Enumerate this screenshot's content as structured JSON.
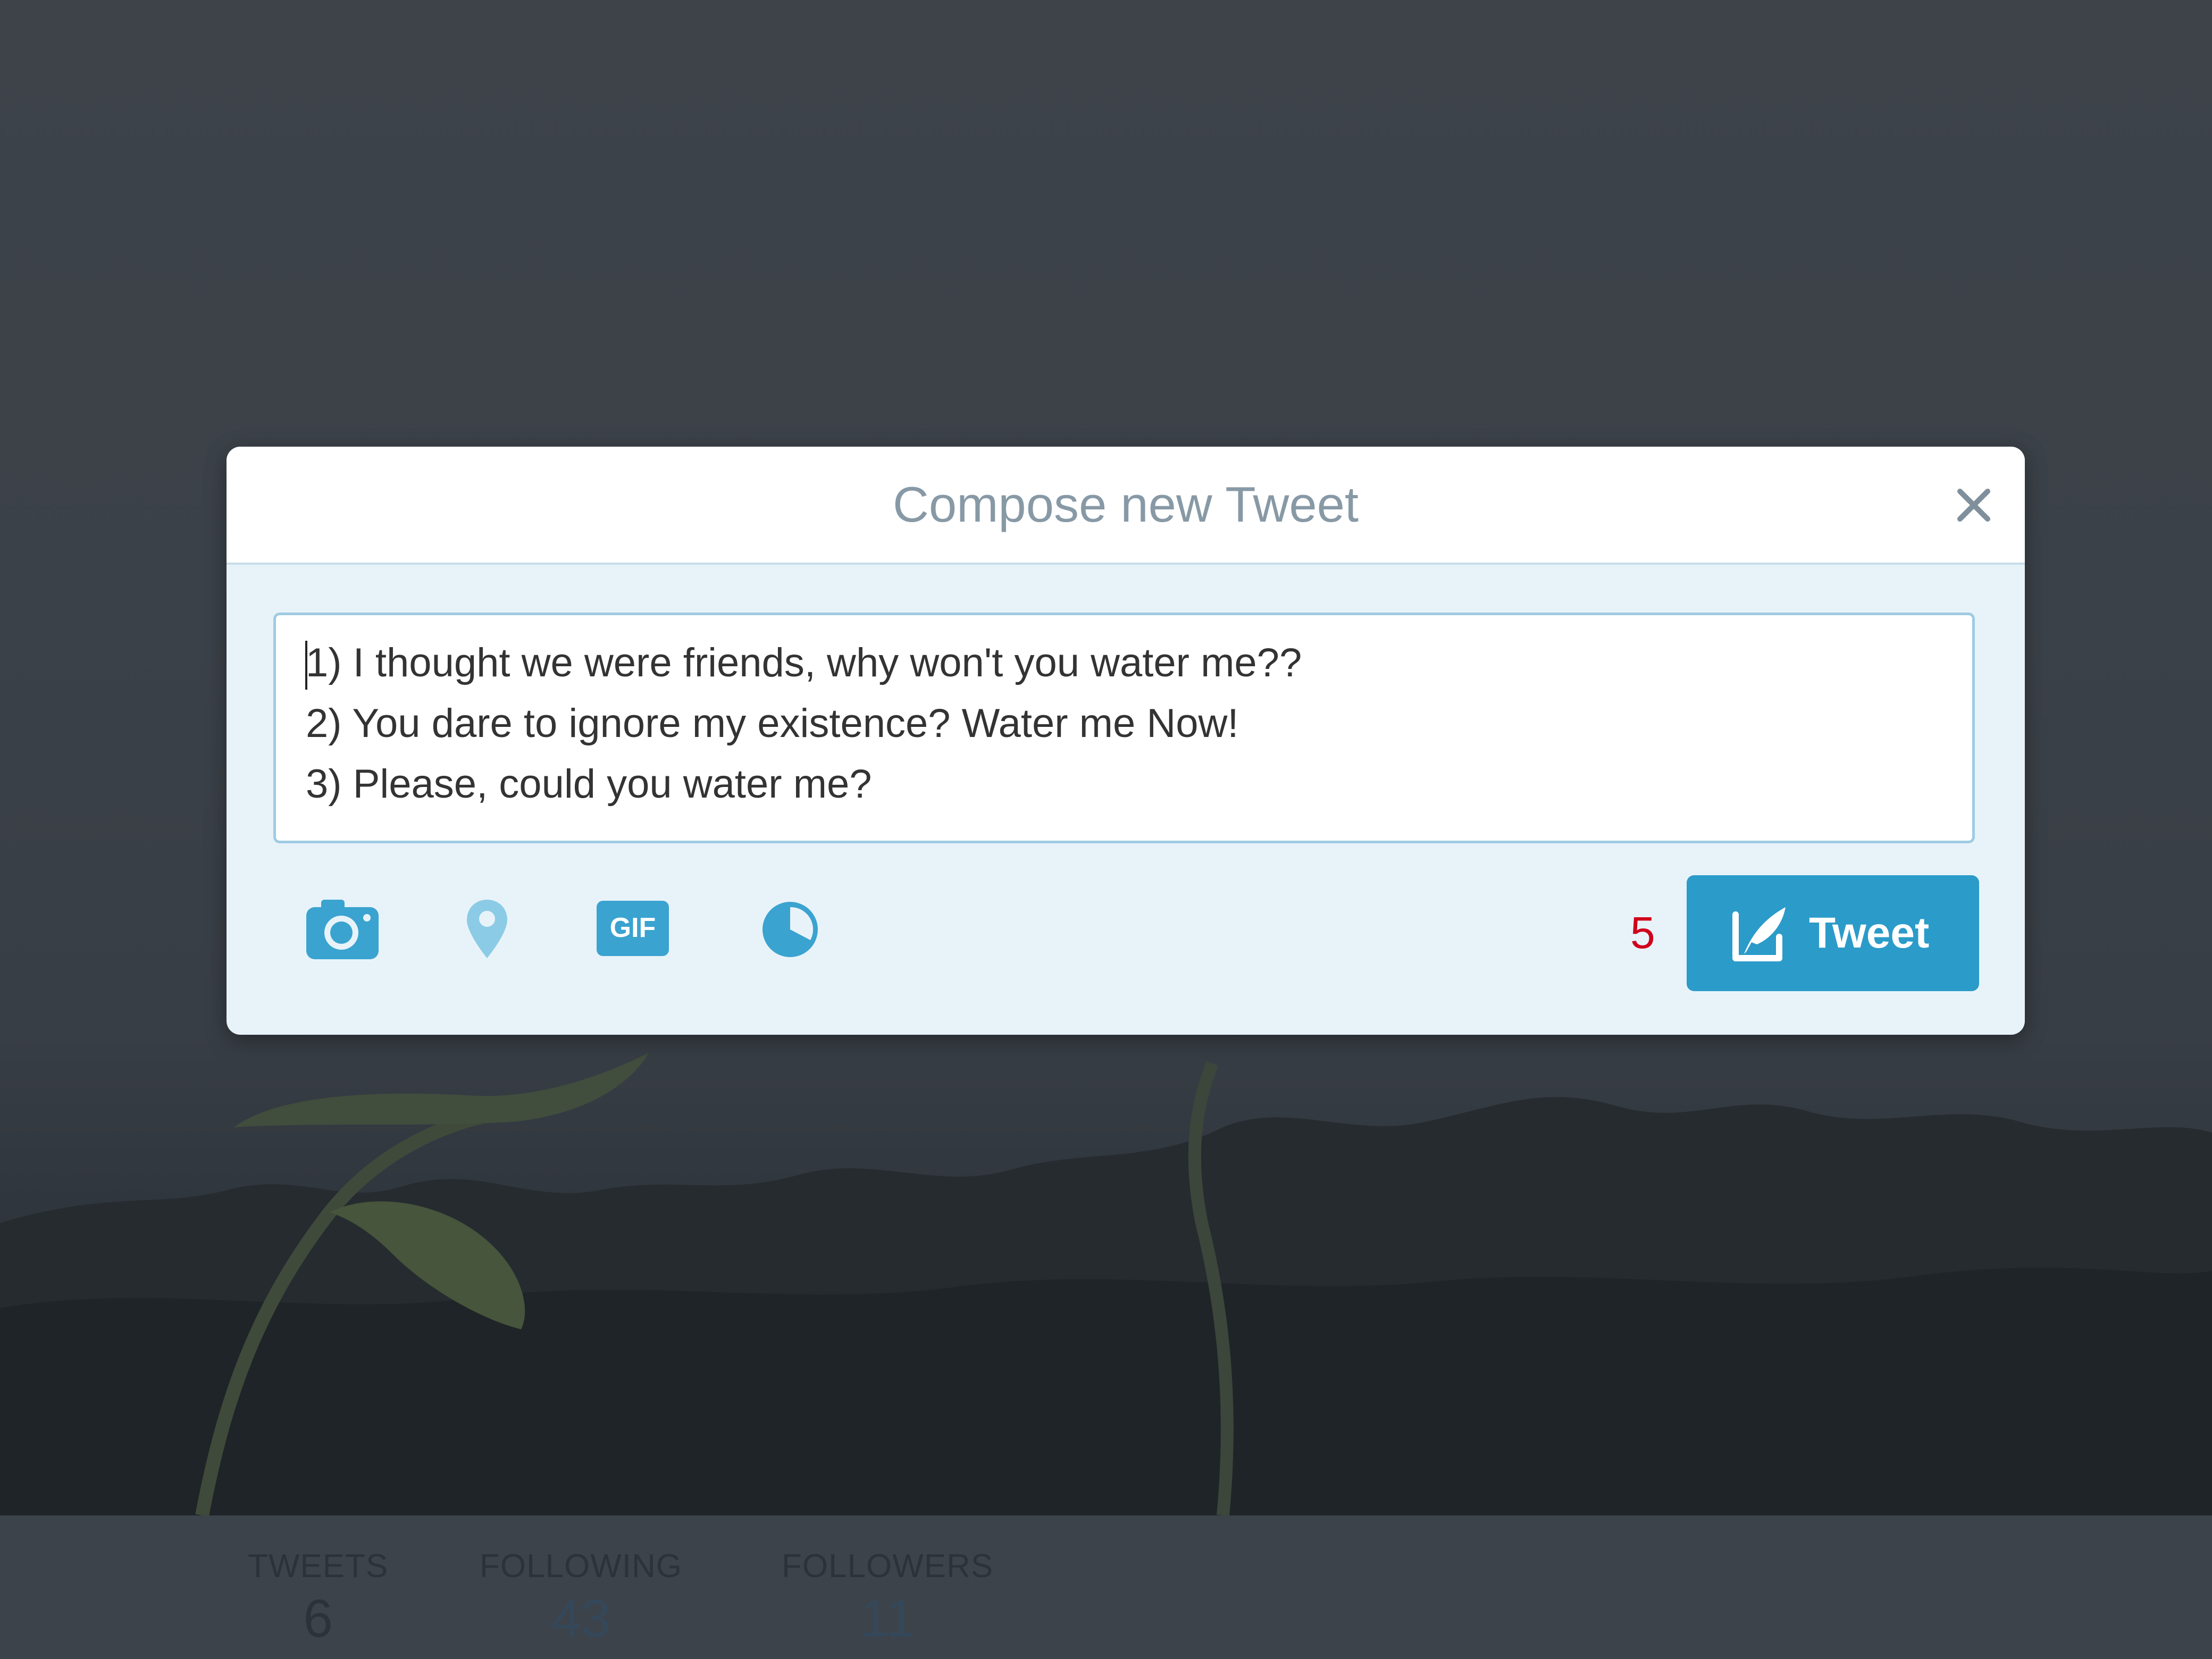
{
  "modal": {
    "title": "Compose new Tweet",
    "tweet_lines": [
      "1) I thought we were friends, why won't you water me??",
      "2) You dare to ignore my existence? Water me Now!",
      "3) Please, could you water me?"
    ],
    "char_counter": "5",
    "tweet_button_label": "Tweet",
    "toolbar_icons": [
      "camera-icon",
      "location-pin-icon",
      "gif-icon",
      "poll-icon"
    ]
  },
  "profile_stats": [
    {
      "label": "TWEETS",
      "value": "6"
    },
    {
      "label": "FOLLOWING",
      "value": "43"
    },
    {
      "label": "FOLLOWERS",
      "value": "11"
    }
  ],
  "colors": {
    "accent": "#2b9bc9",
    "icon": "#3aa3d0",
    "counter_warning": "#d0021b",
    "overlay": "#3c4249"
  }
}
